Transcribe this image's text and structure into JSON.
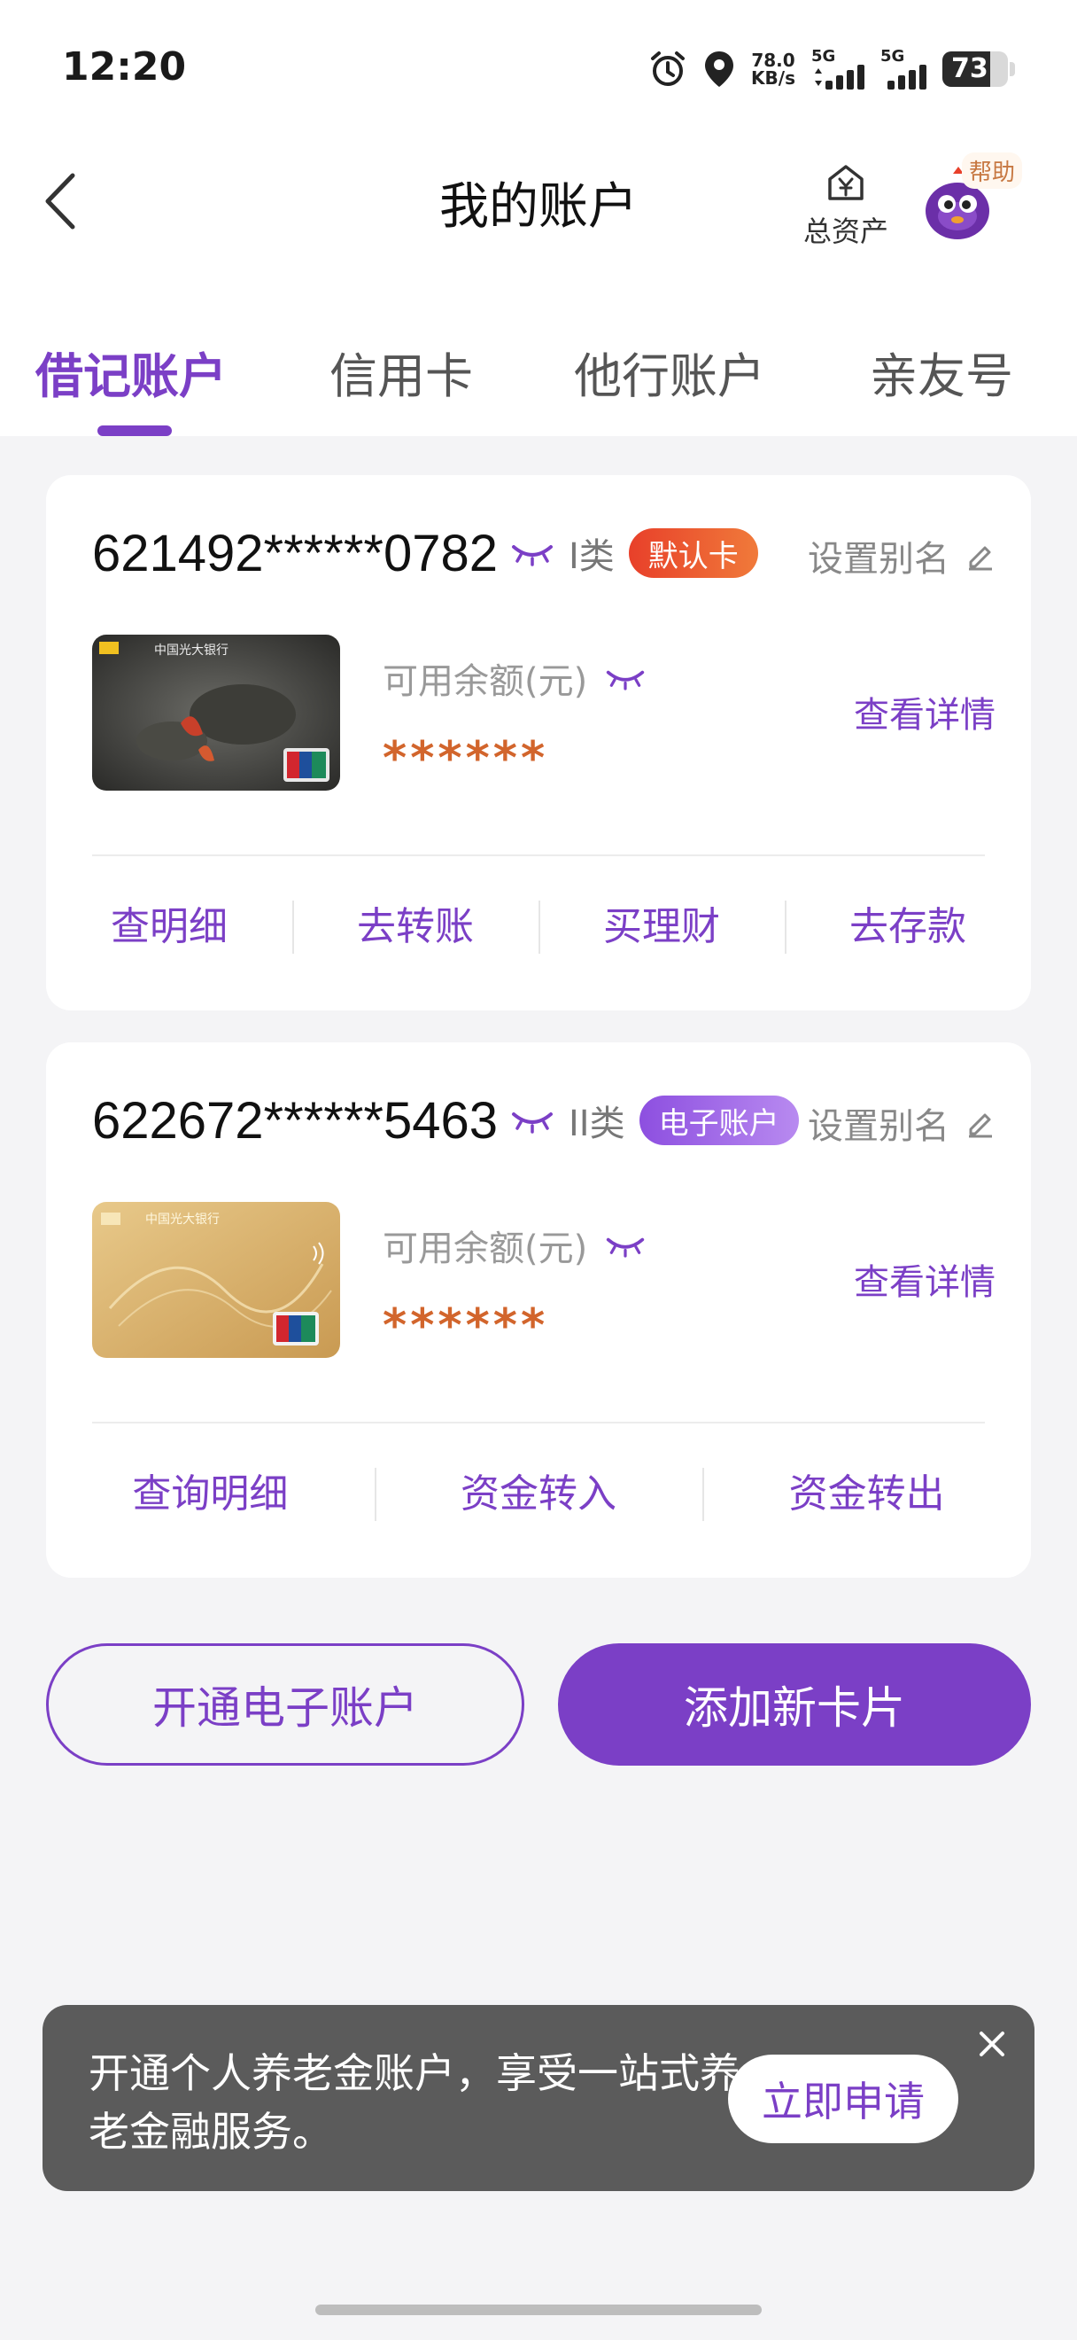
{
  "status_bar": {
    "time": "12:20",
    "net_speed_value": "78.0",
    "net_speed_unit": "KB/s",
    "signal1_label": "5G",
    "signal2_label": "5G",
    "battery": "73",
    "battery_level": 0.73
  },
  "header": {
    "title": "我的账户",
    "assets_label": "总资产",
    "help_label": "帮助"
  },
  "tabs": [
    {
      "label": "借记账户",
      "active": true
    },
    {
      "label": "信用卡",
      "active": false
    },
    {
      "label": "他行账户",
      "active": false
    },
    {
      "label": "亲友号",
      "active": false
    }
  ],
  "accounts": [
    {
      "number": "621492******0782",
      "type": "I类",
      "badge": "默认卡",
      "alias_label": "设置别名",
      "balance_label": "可用余额(元)",
      "balance_masked": "******",
      "detail_link": "查看详情",
      "card_bank_name": "中国光大银行",
      "actions": [
        "查明细",
        "去转账",
        "买理财",
        "去存款"
      ]
    },
    {
      "number": "622672******5463",
      "type": "II类",
      "badge": "电子账户",
      "alias_label": "设置别名",
      "balance_label": "可用余额(元)",
      "balance_masked": "******",
      "detail_link": "查看详情",
      "card_bank_name": "中国光大银行",
      "actions": [
        "查询明细",
        "资金转入",
        "资金转出"
      ]
    }
  ],
  "buttons": {
    "open_e_account": "开通电子账户",
    "add_card": "添加新卡片"
  },
  "promo": {
    "text": "开通个人养老金账户，享受一站式养老金融服务。",
    "cta": "立即申请"
  },
  "colors": {
    "accent": "#7b3fc6",
    "balance": "#d2652c",
    "default_badge": "#e8402a",
    "promo_bg": "#5b5b5b"
  }
}
